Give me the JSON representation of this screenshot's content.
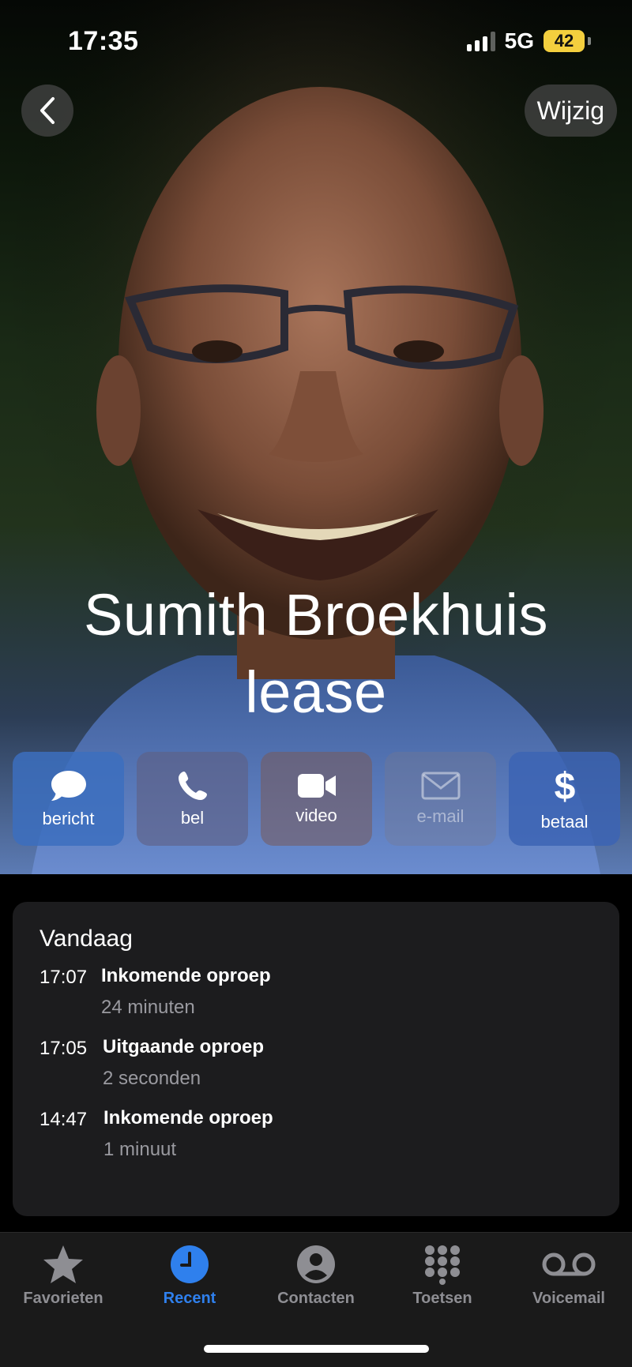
{
  "status": {
    "time": "17:35",
    "network": "5G",
    "battery": "42"
  },
  "nav": {
    "edit_label": "Wijzig"
  },
  "contact": {
    "name_line1": "Sumith Broekhuis",
    "name_line2": "lease"
  },
  "actions": [
    {
      "label": "bericht",
      "icon": "message-icon"
    },
    {
      "label": "bel",
      "icon": "phone-icon"
    },
    {
      "label": "video",
      "icon": "video-icon"
    },
    {
      "label": "e-mail",
      "icon": "mail-icon"
    },
    {
      "label": "betaal",
      "icon": "dollar-icon"
    }
  ],
  "history": {
    "title": "Vandaag",
    "entries": [
      {
        "time": "17:07",
        "type": "Inkomende oproep",
        "duration": "24 minuten"
      },
      {
        "time": "17:05",
        "type": "Uitgaande oproep",
        "duration": "2 seconden"
      },
      {
        "time": "14:47",
        "type": "Inkomende oproep",
        "duration": "1 minuut"
      }
    ]
  },
  "tabs": [
    {
      "label": "Favorieten",
      "icon": "star-icon"
    },
    {
      "label": "Recent",
      "icon": "clock-icon",
      "active": true
    },
    {
      "label": "Contacten",
      "icon": "person-icon"
    },
    {
      "label": "Toetsen",
      "icon": "keypad-icon"
    },
    {
      "label": "Voicemail",
      "icon": "voicemail-icon"
    }
  ],
  "colors": {
    "accent": "#2f80ed",
    "battery": "#f4cf3e",
    "card": "#1c1c1e"
  }
}
